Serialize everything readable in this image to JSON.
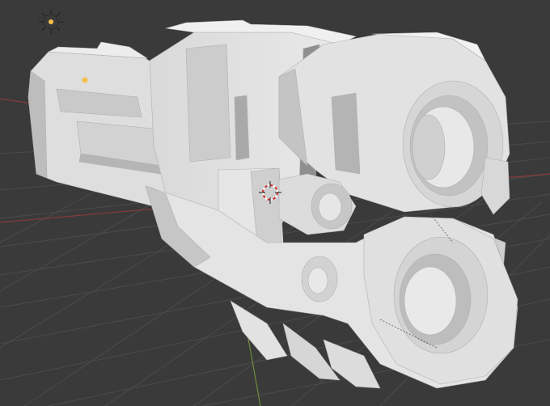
{
  "app": "Blender",
  "viewport": {
    "mode": "solid-shading",
    "background_color": "#3a3a3a",
    "grid_color": "#4a4a4a",
    "axis_x_color": "#8a3a3a",
    "axis_y_color": "#6e8a3a",
    "mesh_light_color": "#e4e4e4",
    "mesh_mid_color": "#cfcfcf",
    "mesh_dark_color": "#9c9c9c"
  },
  "objects": [
    {
      "name": "weapon-mesh",
      "icon": "mesh-object"
    },
    {
      "name": "light",
      "icon": "light-icon",
      "color": "#f5c04a"
    },
    {
      "name": "3d-cursor",
      "icon": "3d-cursor-icon",
      "color": "#d03030"
    }
  ]
}
